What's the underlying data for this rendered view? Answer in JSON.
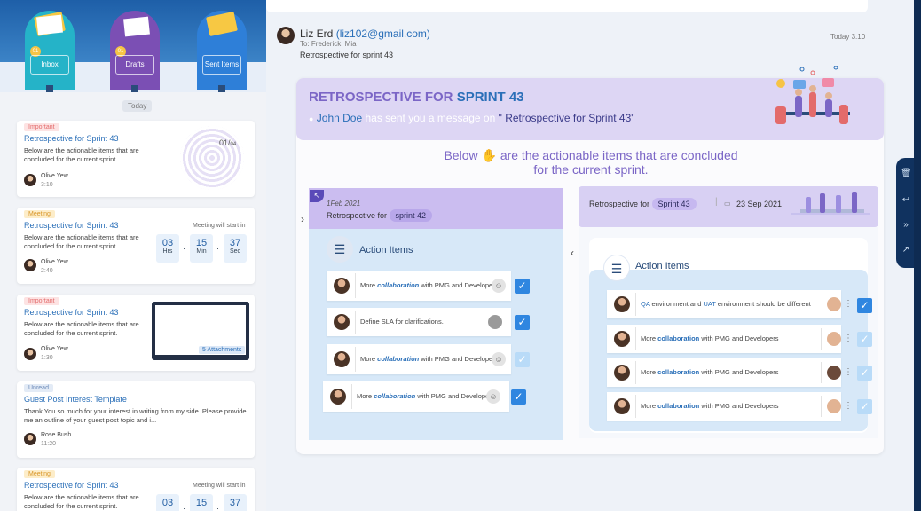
{
  "sidebar": {
    "mailboxes": [
      {
        "label": "Inbox",
        "badge": "01"
      },
      {
        "label": "Drafts",
        "badge": "01"
      },
      {
        "label": "Sent Items"
      }
    ],
    "today_label": "Today",
    "cards": [
      {
        "tag": "Important",
        "title": "Retrospective for Sprint 43",
        "body": "Below are the actionable items that are concluded for the current sprint.",
        "name": "Olive Yew",
        "time": "3:10",
        "progress": "01/",
        "progress_total": "04"
      },
      {
        "tag": "Meeting",
        "title": "Retrospective for Sprint 43",
        "body": "Below are the actionable items that are concluded for the current sprint.",
        "name": "Olive Yew",
        "time": "2:40",
        "meeting_label": "Meeting will start in",
        "countdown": [
          {
            "n": "03",
            "u": "Hrs"
          },
          {
            "n": "15",
            "u": "Min"
          },
          {
            "n": "37",
            "u": "Sec"
          }
        ]
      },
      {
        "tag": "Important",
        "title": "Retrospective for Sprint 43",
        "body": "Below are the actionable items that are concluded for the current sprint.",
        "name": "Olive Yew",
        "time": "1:30",
        "attachments": "5 Attachments"
      },
      {
        "tag": "Unread",
        "title": "Guest Post Interest Template",
        "body": "Thank You so much for your interest in writing from my side. Please provide me an outline of your guest post topic and i...",
        "name": "Rose Bush",
        "time": "11:20"
      },
      {
        "tag": "Meeting",
        "title": "Retrospective for Sprint 43",
        "body": "Below are the actionable items that are concluded for the current sprint.",
        "meeting_label": "Meeting will start in",
        "countdown": [
          {
            "n": "03"
          },
          {
            "n": "15"
          },
          {
            "n": "37"
          }
        ]
      }
    ]
  },
  "email": {
    "sender_name": "Liz Erd",
    "sender_email": "(liz102@gmail.com)",
    "to": "To: Frederick, Mia",
    "subject": "Retrospective for sprint 43",
    "date": "Today 3.10",
    "banner_title_a": "RETROSPECTIVE FOR",
    "banner_title_b": "SPRINT 43",
    "banner_sender": "John Doe",
    "banner_mid": "has sent you a message on",
    "banner_subject": "\" Retrospective for Sprint 43\"",
    "below_a": "Below",
    "below_b": "are the actionable items that are concluded for the current sprint.",
    "left_panel": {
      "date": "1Feb 2021",
      "title": "Retrospective for",
      "sprint": "sprint 42",
      "section": "Action Items",
      "items": [
        {
          "pre": "More ",
          "hl": "collaboration",
          "post": " with PMG and Developers",
          "checked": true
        },
        {
          "pre": "Define SLA for clarifications.",
          "hl": "",
          "post": "",
          "checked": true
        },
        {
          "pre": "More ",
          "hl": "collaboration",
          "post": " with PMG and Developers",
          "checked": false
        },
        {
          "pre": "More ",
          "hl": "collaboration",
          "post": " with PMG and Developers",
          "checked": true
        }
      ]
    },
    "right_panel": {
      "title": "Retrospective for",
      "sprint": "Sprint 43",
      "date": "23 Sep 2021",
      "section": "Action Items",
      "items": [
        {
          "hl1": "QA",
          "mid": " environment and ",
          "hl2": "UAT",
          "post": " environment should be different",
          "checked": true
        },
        {
          "pre": "More ",
          "hl": "collaboration",
          "post": " with PMG and Developers",
          "checked": false
        },
        {
          "pre": "More ",
          "hl": "collaboration",
          "post": " with PMG and Developers",
          "checked": false
        },
        {
          "pre": "More ",
          "hl": "collaboration",
          "post": " with PMG and Developers",
          "checked": false
        }
      ]
    }
  },
  "icons": [
    "trash-icon",
    "reply-icon",
    "forward-icon",
    "share-icon"
  ],
  "colors": {
    "accent": "#2a6fb8",
    "purple": "#7b66c6",
    "check": "#2f86e0"
  }
}
